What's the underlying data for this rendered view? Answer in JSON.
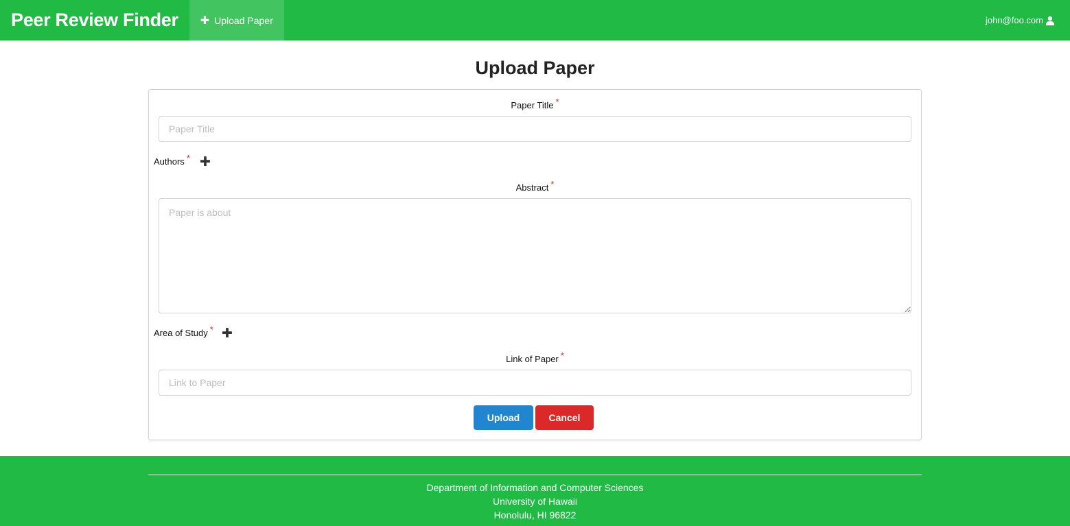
{
  "navbar": {
    "brand": "Peer Review Finder",
    "upload_link": "Upload Paper",
    "user_email": "john@foo.com"
  },
  "page": {
    "title": "Upload Paper"
  },
  "form": {
    "paper_title_label": "Paper Title",
    "paper_title_placeholder": "Paper Title",
    "authors_label": "Authors",
    "abstract_label": "Abstract",
    "abstract_placeholder": "Paper is about",
    "area_label": "Area of Study",
    "link_label": "Link of Paper",
    "link_placeholder": "Link to Paper",
    "required_mark": "*",
    "upload_button": "Upload",
    "cancel_button": "Cancel"
  },
  "footer": {
    "line1": "Department of Information and Computer Sciences",
    "line2": "University of Hawaii",
    "line3": "Honolulu, HI 96822"
  },
  "colors": {
    "brand_green": "#21ba45",
    "primary_blue": "#2185d0",
    "danger_red": "#db2828"
  },
  "icons": {
    "upload_link_icon": "plus-icon",
    "user_icon": "user-icon",
    "add_author_icon": "plus-icon",
    "add_area_icon": "plus-icon"
  }
}
